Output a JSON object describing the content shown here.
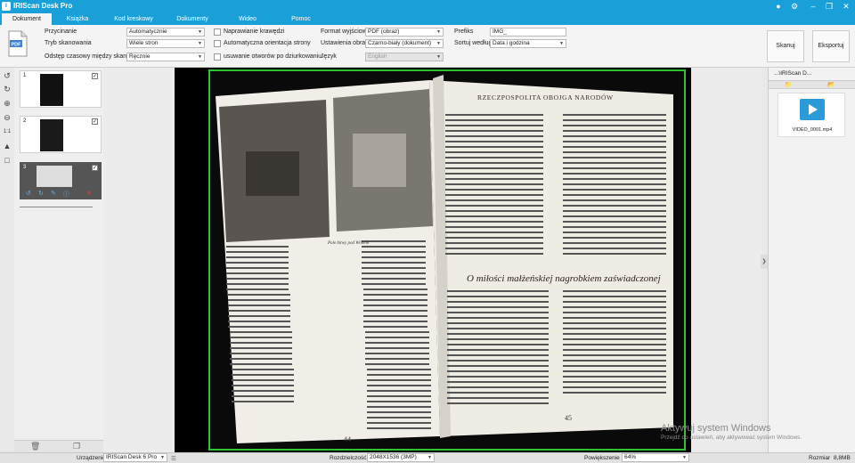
{
  "app": {
    "title": "IRIScan Desk Pro",
    "icon_letter": "i"
  },
  "window_buttons": [
    "globe-icon",
    "gear-icon",
    "minimize-icon",
    "restore-icon",
    "close-icon"
  ],
  "tabs": [
    {
      "label": "Dokument",
      "active": true
    },
    {
      "label": "Książka",
      "active": false
    },
    {
      "label": "Kod kreskowy",
      "active": false
    },
    {
      "label": "Dokumenty tożsamości",
      "active": false
    },
    {
      "label": "Wideo",
      "active": false
    },
    {
      "label": "Pomoc",
      "active": false
    }
  ],
  "toolbar": {
    "crop_label": "Przycinanie",
    "crop_value": "Automatycznie",
    "scan_mode_label": "Tryb skanowania",
    "scan_mode_value": "Wiele stron",
    "interval_label": "Odstęp czasowy między skanami",
    "interval_value": "Ręcznie",
    "fix_edges": "Naprawianie krawędzi",
    "auto_orient": "Automatyczna orientacja strony",
    "remove_holes": "usuwanie otworów po dziurkowaniu",
    "format_label": "Format wyjściowy",
    "format_value": "PDF (obraz)",
    "image_settings_label": "Ustawienia obrazu",
    "image_settings_value": "Czarno-biały (dokument)",
    "language_label": "Język",
    "language_value": "English",
    "prefix_label": "Prefiks",
    "prefix_value": "IMG_",
    "sort_label": "Sortuj według",
    "sort_value": "Data i godzina",
    "scan_button": "Skanuj",
    "export_button": "Eksportuj"
  },
  "thumbnails": [
    {
      "num": "1",
      "checked": true
    },
    {
      "num": "2",
      "checked": true
    },
    {
      "num": "3",
      "checked": true
    }
  ],
  "checkmark": "✓",
  "right_panel": {
    "path": "...\\IRIScan D...",
    "file_name": "VIDEO_0001.mp4"
  },
  "status": {
    "device_label": "Urządzenie",
    "device_value": "IRIScan Desk 6 Pro",
    "resolution_label": "Rozdzielczość",
    "resolution_value": "2048X1536 (3MP)",
    "zoom_label": "Powiększenie",
    "zoom_value": "64%",
    "size_label": "Rozmiar",
    "size_value": "8,8MB"
  },
  "windows_activation": {
    "line1": "Aktywuj system Windows",
    "line2": "Przejdź do ustawień, aby aktywować system Windows."
  },
  "book": {
    "header": "RZECZPOSPOLITA OBOJGA NARODÓW",
    "heading": "O miłości małżeńskiej nagrobkiem zaświadczonej",
    "page_left": "44",
    "page_right": "45",
    "caption": "Pole bitwy pod Wilnem"
  }
}
